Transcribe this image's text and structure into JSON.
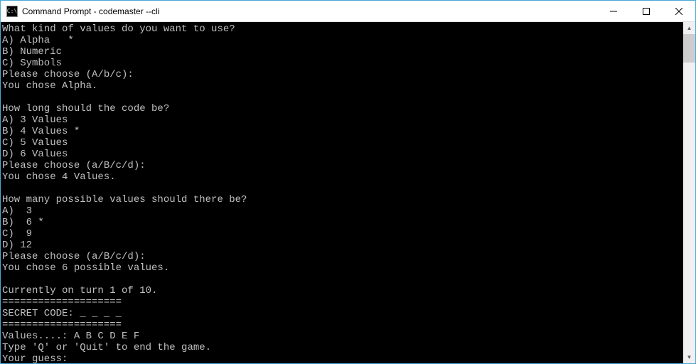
{
  "window": {
    "title": "Command Prompt - codemaster  --cli",
    "icon_label": "C:\\"
  },
  "lines": [
    "What kind of values do you want to use?",
    "A) Alpha   *",
    "B) Numeric",
    "C) Symbols",
    "Please choose (A/b/c):",
    "You chose Alpha.",
    "",
    "How long should the code be?",
    "A) 3 Values",
    "B) 4 Values *",
    "C) 5 Values",
    "D) 6 Values",
    "Please choose (a/B/c/d):",
    "You chose 4 Values.",
    "",
    "How many possible values should there be?",
    "A)  3",
    "B)  6 *",
    "C)  9",
    "D) 12",
    "Please choose (a/B/c/d):",
    "You chose 6 possible values.",
    "",
    "Currently on turn 1 of 10.",
    "====================",
    "SECRET CODE: _ _ _ _",
    "====================",
    "Values....: A B C D E F",
    "Type 'Q' or 'Quit' to end the game.",
    "Your guess:"
  ]
}
